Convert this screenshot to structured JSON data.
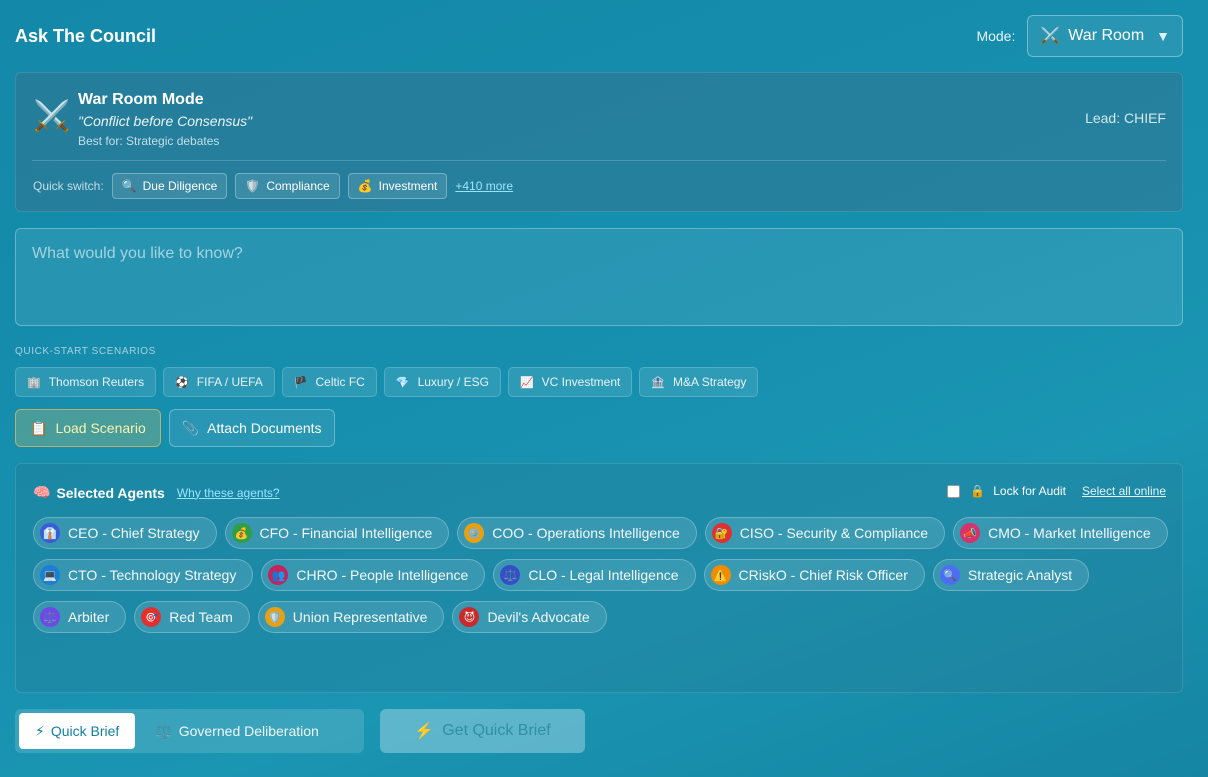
{
  "header": {
    "title": "Ask The Council",
    "mode_label": "Mode:",
    "mode_icon": "⚔️",
    "mode_value": "War Room",
    "caret": "▼"
  },
  "mode_card": {
    "icon": "⚔️",
    "name": "War Room Mode",
    "quote": "\"Conflict before Consensus\"",
    "best_for": "Best for: Strategic debates",
    "lead": "Lead: CHIEF",
    "quick_switch_label": "Quick switch:",
    "quick_switch": [
      {
        "icon": "🔍",
        "label": "Due Diligence"
      },
      {
        "icon": "🛡️",
        "label": "Compliance"
      },
      {
        "icon": "💰",
        "label": "Investment"
      }
    ],
    "more_link": "+410 more"
  },
  "question": {
    "placeholder": "What would you like to know?"
  },
  "scenarios": {
    "heading": "QUICK-START SCENARIOS",
    "items": [
      {
        "icon": "🏢",
        "label": "Thomson Reuters"
      },
      {
        "icon": "⚽",
        "label": "FIFA / UEFA"
      },
      {
        "icon": "🏴",
        "label": "Celtic FC"
      },
      {
        "icon": "💎",
        "label": "Luxury / ESG"
      },
      {
        "icon": "📈",
        "label": "VC Investment"
      },
      {
        "icon": "🏦",
        "label": "M&A Strategy"
      }
    ]
  },
  "actions": {
    "load_icon": "📋",
    "load_label": "Load Scenario",
    "attach_icon": "📎",
    "attach_label": "Attach Documents"
  },
  "agents": {
    "title_icon": "🧠",
    "title": "Selected Agents",
    "why_link": "Why these agents?",
    "lock_icon": "🔒",
    "lock_label": "Lock for Audit",
    "select_all": "Select all online",
    "items": [
      {
        "icon": "👔",
        "label": "CEO - Chief Strategy",
        "color": "#3b5bdb"
      },
      {
        "icon": "💰",
        "label": "CFO - Financial Intelligence",
        "color": "#2f9e44"
      },
      {
        "icon": "⚙️",
        "label": "COO - Operations Intelligence",
        "color": "#e8a010"
      },
      {
        "icon": "🔐",
        "label": "CISO - Security & Compliance",
        "color": "#e03131"
      },
      {
        "icon": "📣",
        "label": "CMO - Market Intelligence",
        "color": "#d6336c"
      },
      {
        "icon": "💻",
        "label": "CTO - Technology Strategy",
        "color": "#1c7ed6"
      },
      {
        "icon": "👥",
        "label": "CHRO - People Intelligence",
        "color": "#c2255c"
      },
      {
        "icon": "⚖️",
        "label": "CLO - Legal Intelligence",
        "color": "#364fc7"
      },
      {
        "icon": "⚠️",
        "label": "CRiskO - Chief Risk Officer",
        "color": "#f08c00"
      },
      {
        "icon": "🔍",
        "label": "Strategic Analyst",
        "color": "#4c6ef5"
      },
      {
        "icon": "⚖️",
        "label": "Arbiter",
        "color": "#7048e8"
      },
      {
        "icon": "🎯",
        "label": "Red Team",
        "color": "#e03131"
      },
      {
        "icon": "🛡️",
        "label": "Union Representative",
        "color": "#e8a010"
      },
      {
        "icon": "😈",
        "label": "Devil's Advocate",
        "color": "#c92a2a"
      }
    ]
  },
  "footer": {
    "quick_brief_icon": "⚡",
    "quick_brief_label": "Quick Brief",
    "governed_icon": "⚖️",
    "governed_label": "Governed Deliberation",
    "get_icon": "⚡",
    "get_label": "Get Quick Brief"
  }
}
